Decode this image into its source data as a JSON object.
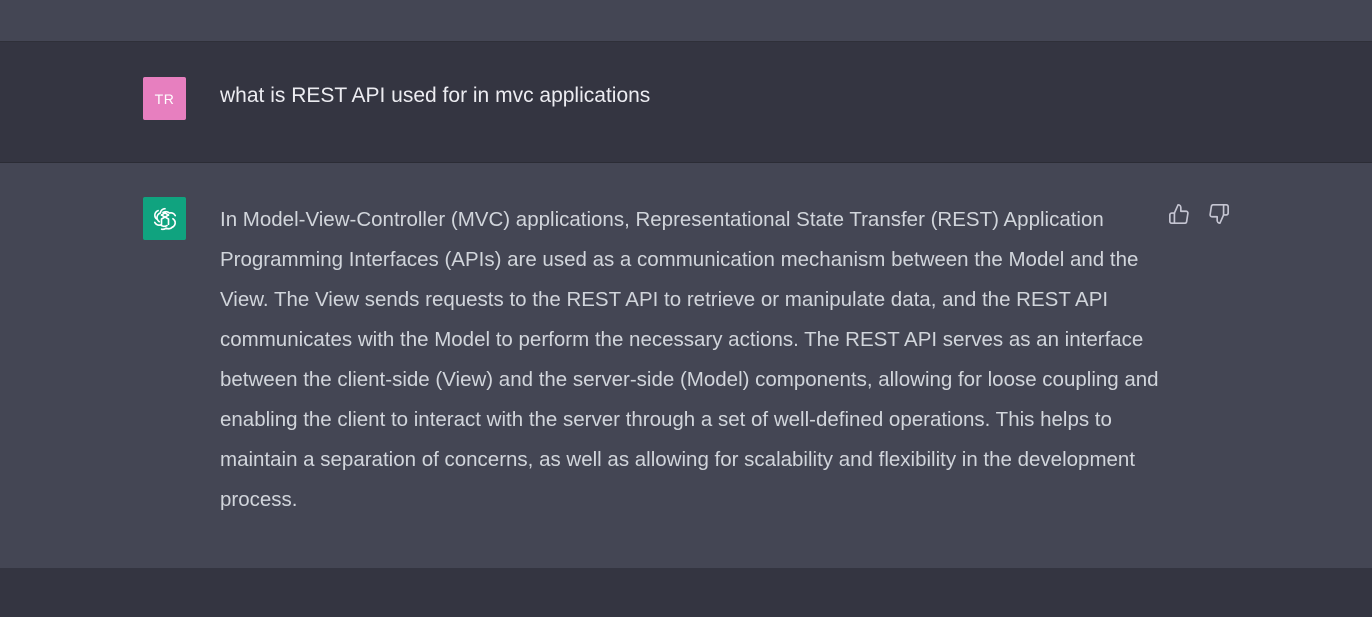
{
  "user_message": {
    "avatar_initials": "TR",
    "avatar_color": "#e77fbf",
    "text": "what is REST API used for in mvc applications"
  },
  "assistant_message": {
    "avatar_icon": "openai-logo-icon",
    "avatar_color": "#10a37f",
    "text": "In Model-View-Controller (MVC) applications, Representational State Transfer (REST) Application Programming Interfaces (APIs) are used as a communication mechanism between the Model and the View. The View sends requests to the REST API to retrieve or manipulate data, and the REST API communicates with the Model to perform the necessary actions. The REST API serves as an interface between the client-side (View) and the server-side (Model) components, allowing for loose coupling and enabling the client to interact with the server through a set of well-defined operations. This helps to maintain a separation of concerns, as well as allowing for scalability and flexibility in the development process.",
    "feedback": {
      "up_icon": "thumbs-up-icon",
      "down_icon": "thumbs-down-icon"
    }
  },
  "colors": {
    "background_dark": "#343541",
    "background_light": "#444654",
    "text_primary": "#ececf1",
    "text_secondary": "#d1d5db"
  }
}
